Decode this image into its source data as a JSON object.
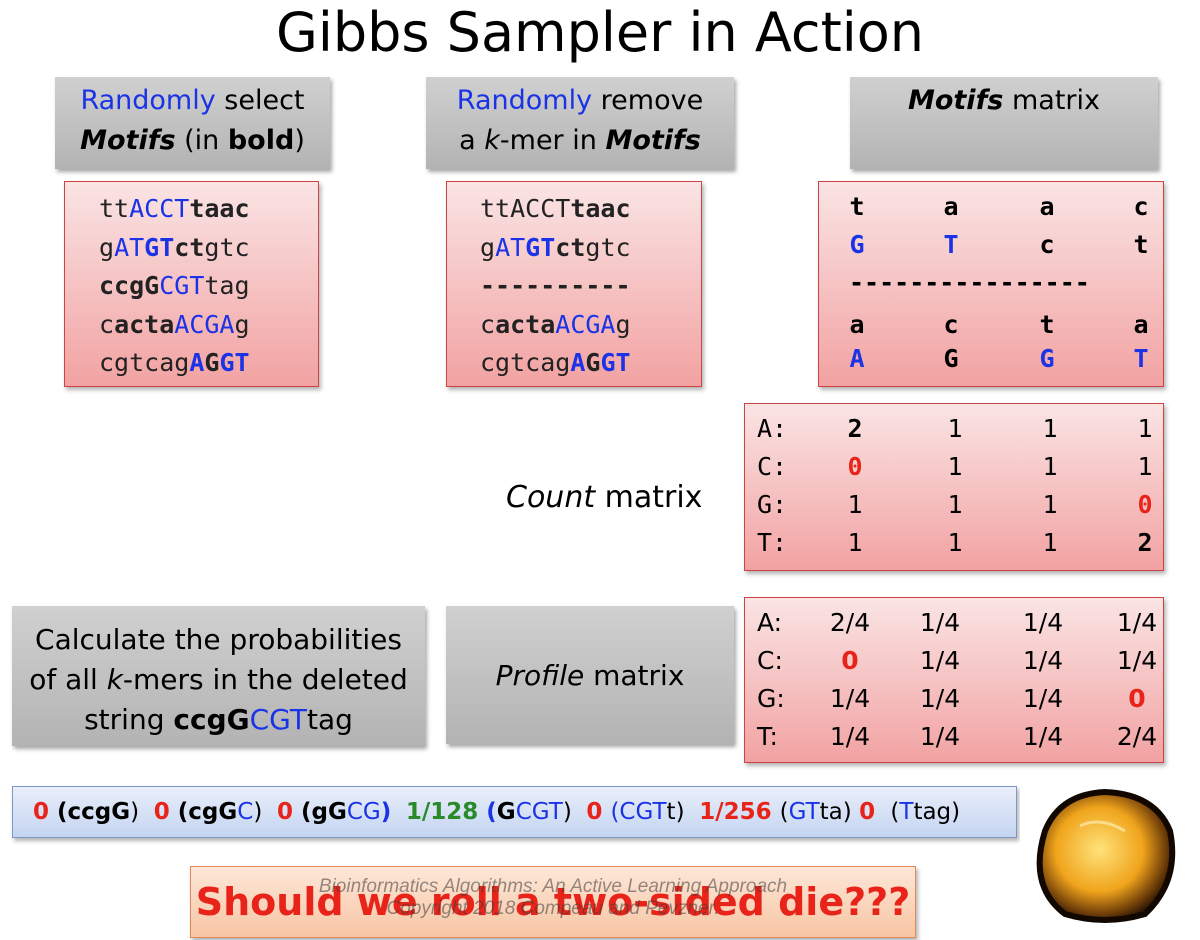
{
  "title": "Gibbs Sampler in Action",
  "box1": {
    "w1": "Randomly",
    "w2": " select",
    "w3": "Motifs",
    "w4": " (in ",
    "w5": "bold",
    "w6": ")"
  },
  "box2": {
    "w1": "Randomly",
    "w2": " remove",
    "w3": "a ",
    "w4": "k",
    "w5": "-mer in ",
    "w6": "Motifs"
  },
  "box3": {
    "w1": "Motifs",
    "w2": " matrix"
  },
  "seq1": [
    [
      [
        "tt",
        ""
      ],
      [
        "ACC",
        "blue"
      ],
      [
        "T",
        "blue"
      ],
      [
        "taac",
        "b"
      ]
    ],
    [
      [
        "g",
        ""
      ],
      [
        "AT",
        "blue"
      ],
      [
        "GT",
        "blue b"
      ],
      [
        "ct",
        "b"
      ],
      [
        "gtc",
        ""
      ]
    ],
    [
      [
        "ccgG",
        "b"
      ],
      [
        "CGT",
        "blue"
      ],
      [
        "tag",
        ""
      ]
    ],
    [
      [
        "c",
        ""
      ],
      [
        "acta",
        "b"
      ],
      [
        "ACGA",
        "blue"
      ],
      [
        "g",
        ""
      ]
    ],
    [
      [
        "cgtcag",
        ""
      ],
      [
        "A",
        "blue b"
      ],
      [
        "G",
        "b"
      ],
      [
        "GT",
        "blue b"
      ]
    ]
  ],
  "seq2": [
    [
      [
        "ttACCT",
        ""
      ],
      [
        "taac",
        "b"
      ]
    ],
    [
      [
        "g",
        ""
      ],
      [
        "AT",
        "blue"
      ],
      [
        "GT",
        "blue b"
      ],
      [
        "ct",
        "b"
      ],
      [
        "gtc",
        ""
      ]
    ],
    [
      [
        "----------",
        "b"
      ]
    ],
    [
      [
        "c",
        ""
      ],
      [
        "acta",
        "b"
      ],
      [
        "ACGA",
        "blue"
      ],
      [
        "g",
        ""
      ]
    ],
    [
      [
        "cgtcag",
        ""
      ],
      [
        "A",
        "blue b"
      ],
      [
        "G",
        "b"
      ],
      [
        "GT",
        "blue b"
      ]
    ]
  ],
  "motifs_matrix": {
    "row1": [
      "t",
      "a",
      "a",
      "c"
    ],
    "row2": [
      "G",
      "T",
      "c",
      "t"
    ],
    "dash": "----------------",
    "row4": [
      "a",
      "c",
      "t",
      "a"
    ],
    "row5": [
      "A",
      "G",
      "G",
      "T"
    ]
  },
  "count_label": {
    "w1": "Count",
    "w2": " matrix"
  },
  "count_matrix": {
    "labels": [
      "A:",
      "C:",
      "G:",
      "T:"
    ],
    "rows": [
      [
        "2",
        "1",
        "1",
        "1"
      ],
      [
        "0",
        "1",
        "1",
        "1"
      ],
      [
        "1",
        "1",
        "1",
        "0"
      ],
      [
        "1",
        "1",
        "1",
        "2"
      ]
    ]
  },
  "calc_box": {
    "l1": "Calculate the probabilities",
    "l2a": "of all ",
    "l2b": "k",
    "l2c": "-mers in the deleted",
    "l3a": "string ",
    "l3b": "ccgG",
    "l3c": "CGT",
    "l3d": "tag"
  },
  "profile_label": {
    "w1": "Profile",
    "w2": " matrix"
  },
  "profile_matrix": {
    "labels": [
      "A:",
      "C:",
      "G:",
      "T:"
    ],
    "rows": [
      [
        "2/4",
        "1/4",
        "1/4",
        "1/4"
      ],
      [
        "0",
        "1/4",
        "1/4",
        "1/4"
      ],
      [
        "1/4",
        "1/4",
        "1/4",
        "0"
      ],
      [
        "1/4",
        "1/4",
        "1/4",
        "2/4"
      ]
    ]
  },
  "prob_line": [
    [
      "0 ",
      "r b"
    ],
    [
      "(",
      "b"
    ],
    [
      "ccgG",
      "b"
    ],
    [
      ")  ",
      ""
    ],
    [
      "0 ",
      "r b"
    ],
    [
      "(",
      "b"
    ],
    [
      "cgG",
      "b"
    ],
    [
      "C",
      "blue"
    ],
    [
      ")  ",
      ""
    ],
    [
      "0 ",
      "r b"
    ],
    [
      "(",
      "b"
    ],
    [
      "gG",
      "b"
    ],
    [
      "CG",
      "blue"
    ],
    [
      ")",
      "blue b"
    ],
    [
      "  ",
      ""
    ],
    [
      "1/128 ",
      "g b"
    ],
    [
      "(",
      "blue b"
    ],
    [
      "G",
      "b"
    ],
    [
      "CGT",
      "blue"
    ],
    [
      ")  ",
      ""
    ],
    [
      "0 ",
      "r b"
    ],
    [
      "(",
      "blue"
    ],
    [
      "CGT",
      "blue"
    ],
    [
      "t",
      ""
    ],
    [
      ")  ",
      ""
    ],
    [
      "1/256 ",
      "r b"
    ],
    [
      "(",
      ""
    ],
    [
      "GT",
      "blue"
    ],
    [
      "ta) ",
      ""
    ],
    [
      "0 ",
      "r b"
    ],
    [
      " (",
      ""
    ],
    [
      "T",
      "blue"
    ],
    [
      "tag)",
      ""
    ]
  ],
  "question": "Should we roll a two-sided die???",
  "watermark": {
    "l1": "Bioinformatics Algorithms: An Active Learning Approach",
    "l2": "Copyright 2018 Compeau and Pevzner."
  },
  "colors": {
    "blue": "#1a33e6",
    "red": "#e8241a",
    "green": "#2a8a2a"
  }
}
